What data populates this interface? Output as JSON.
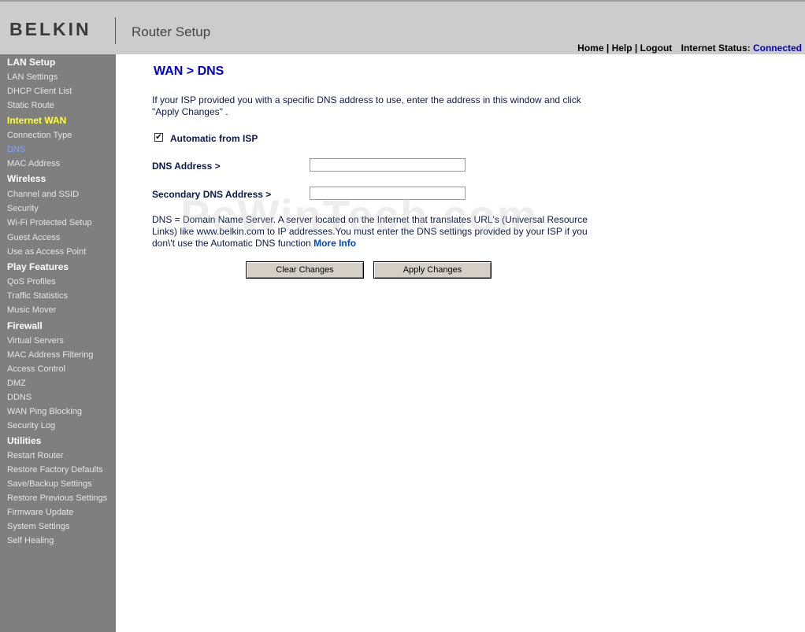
{
  "header": {
    "brand": "BELKIN",
    "product": "Router Setup",
    "nav": [
      "Home",
      "Help",
      "Logout"
    ],
    "nav_separator": "|",
    "status_label": "Internet Status:",
    "status_value": "Connected",
    "status_color": "#0000cc"
  },
  "sidebar": {
    "sections": [
      {
        "title": "LAN Setup",
        "items": [
          "LAN Settings",
          "DHCP Client List",
          "Static Route"
        ]
      },
      {
        "title": "Internet WAN",
        "items": [
          "Connection Type",
          "DNS",
          "MAC Address"
        ]
      },
      {
        "title": "Wireless",
        "items": [
          "Channel and SSID",
          "Security",
          "Wi-Fi Protected Setup",
          "Guest Access",
          "Use as Access Point"
        ]
      },
      {
        "title": "Play Features",
        "items": [
          "QoS Profiles",
          "Traffic Statistics",
          "Music Mover"
        ]
      },
      {
        "title": "Firewall",
        "items": [
          "Virtual Servers",
          "MAC Address Filtering",
          "Access Control",
          "DMZ",
          "DDNS",
          "WAN Ping Blocking",
          "Security Log"
        ]
      },
      {
        "title": "Utilities",
        "items": [
          "Restart Router",
          "Restore Factory Defaults",
          "Save/Backup Settings",
          "Restore Previous Settings",
          "Firmware Update",
          "System Settings",
          "Self Healing"
        ]
      }
    ],
    "active_section": "Internet WAN",
    "active_item": "DNS"
  },
  "main": {
    "title": "WAN > DNS",
    "intro": "If your ISP provided you with a specific DNS address to use, enter the address in this window and click \"Apply Changes\" .",
    "auto_label": "Automatic from ISP",
    "auto_checked": true,
    "check_glyph": "✔",
    "dns_label": "DNS Address >",
    "dns_value": "",
    "secondary_dns_label": "Secondary DNS Address >",
    "secondary_dns_value": "",
    "description": "DNS = Domain Name Server. A server located on the Internet that translates URL's (Universal Resource Links) like www.belkin.com to IP addresses.You must enter the DNS settings provided by your ISP if you don\\'t use the Automatic DNS function",
    "more_info": "More Info",
    "clear_button": "Clear Changes",
    "apply_button": "Apply Changes"
  },
  "watermark": "PcWinTech.com"
}
